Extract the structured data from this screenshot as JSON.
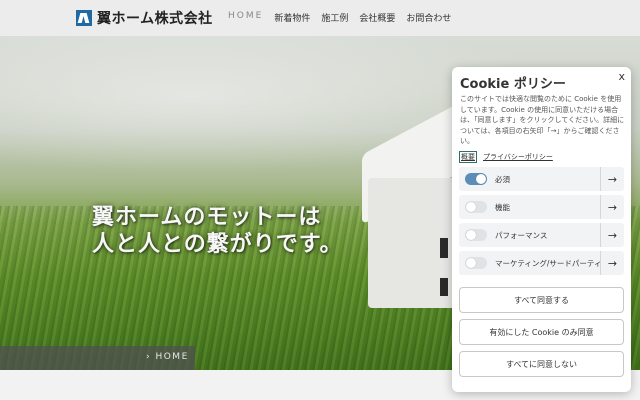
{
  "header": {
    "logo_text": "翼ホーム株式会社",
    "nav": [
      "HOME",
      "新着物件",
      "施工例",
      "会社概要",
      "お問合わせ"
    ]
  },
  "hero": {
    "motto_line1": "翼ホームのモットーは",
    "motto_line2": "人と人との繋がりです。",
    "breadcrumb": "› HOME"
  },
  "cookie": {
    "close": "x",
    "title": "Cookie ポリシー",
    "description": "このサイトでは快適な閲覧のために Cookie を使用しています。Cookie の使用に同意いただける場合は、「同意します」をクリックしてください。詳細については、各項目の右矢印「→」からご確認ください。",
    "link_overview": "概要",
    "link_privacy": "プライバシーポリシー",
    "categories": [
      {
        "label": "必須",
        "enabled": true
      },
      {
        "label": "機能",
        "enabled": false
      },
      {
        "label": "パフォーマンス",
        "enabled": false
      },
      {
        "label": "マーケティング/サードパーティ",
        "enabled": false
      }
    ],
    "arrow": "→",
    "accept_all": "すべて同意する",
    "accept_enabled": "有効にした Cookie のみ同意",
    "reject_all": "すべてに同意しない"
  },
  "colors": {
    "toggle_on": "#5b8db8",
    "logo_blue": "#1f6aa5"
  }
}
